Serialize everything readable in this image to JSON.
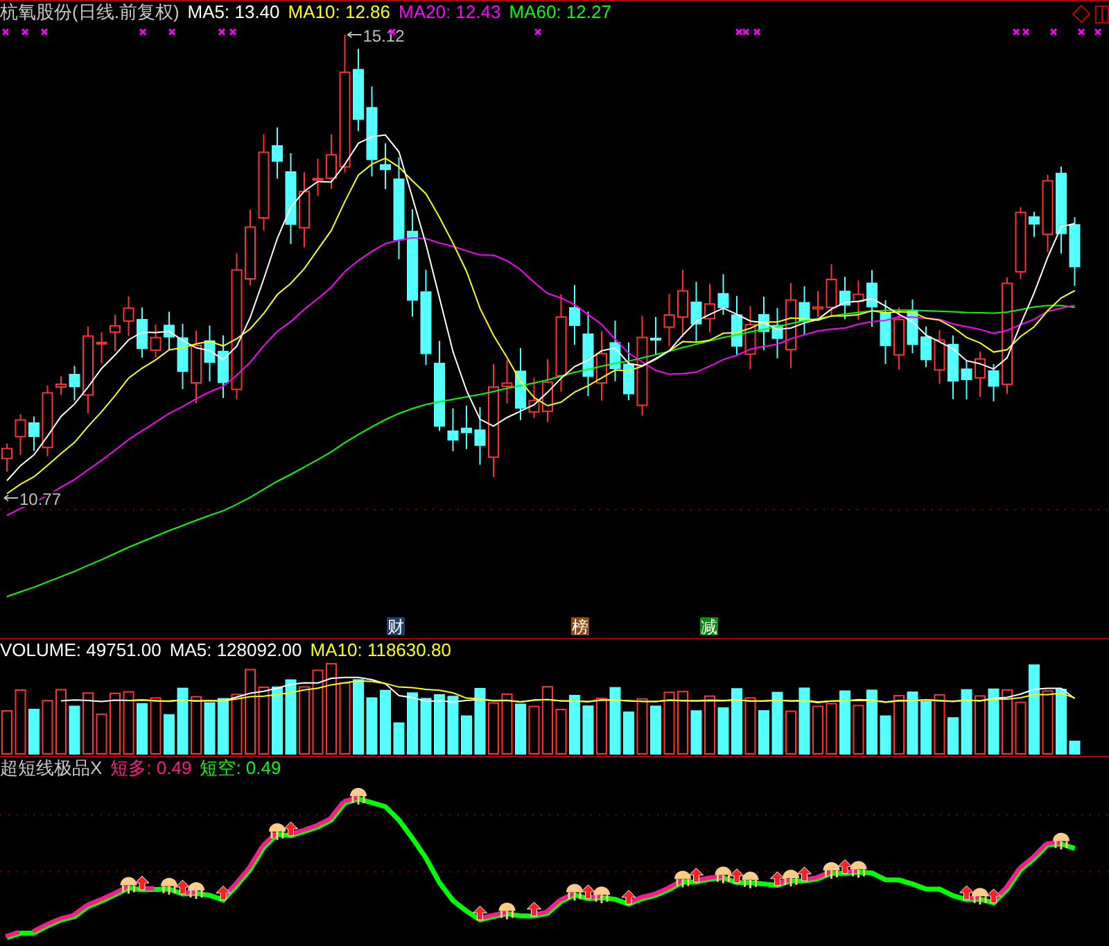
{
  "main_chart": {
    "stock_title": "杭氧股份(日线.前复权)",
    "ma_readings": [
      {
        "label": "MA5: 13.40",
        "color": "#ffffff"
      },
      {
        "label": "MA10: 12.86",
        "color": "#ffff00"
      },
      {
        "label": "MA20: 12.43",
        "color": "#ff00ff"
      },
      {
        "label": "MA60: 12.27",
        "color": "#00ff00"
      }
    ],
    "high_label": "15.12",
    "low_label": "10.77",
    "event_badges": [
      {
        "text": "财",
        "color": "#1c4070"
      },
      {
        "text": "榜",
        "color": "#8a4a10"
      },
      {
        "text": "减",
        "color": "#108a10"
      }
    ]
  },
  "volume_chart": {
    "readings": [
      {
        "label": "VOLUME: 49751.00",
        "color": "#ffffff"
      },
      {
        "label": "MA5: 128092.00",
        "color": "#ffffff"
      },
      {
        "label": "MA10: 118630.80",
        "color": "#ffff00"
      }
    ]
  },
  "indicator_chart": {
    "title": "超短线极品X",
    "readings": [
      {
        "label": "短多: 0.49",
        "color": "#ff1a8c"
      },
      {
        "label": "短空: 0.49",
        "color": "#00ff00"
      }
    ]
  }
}
